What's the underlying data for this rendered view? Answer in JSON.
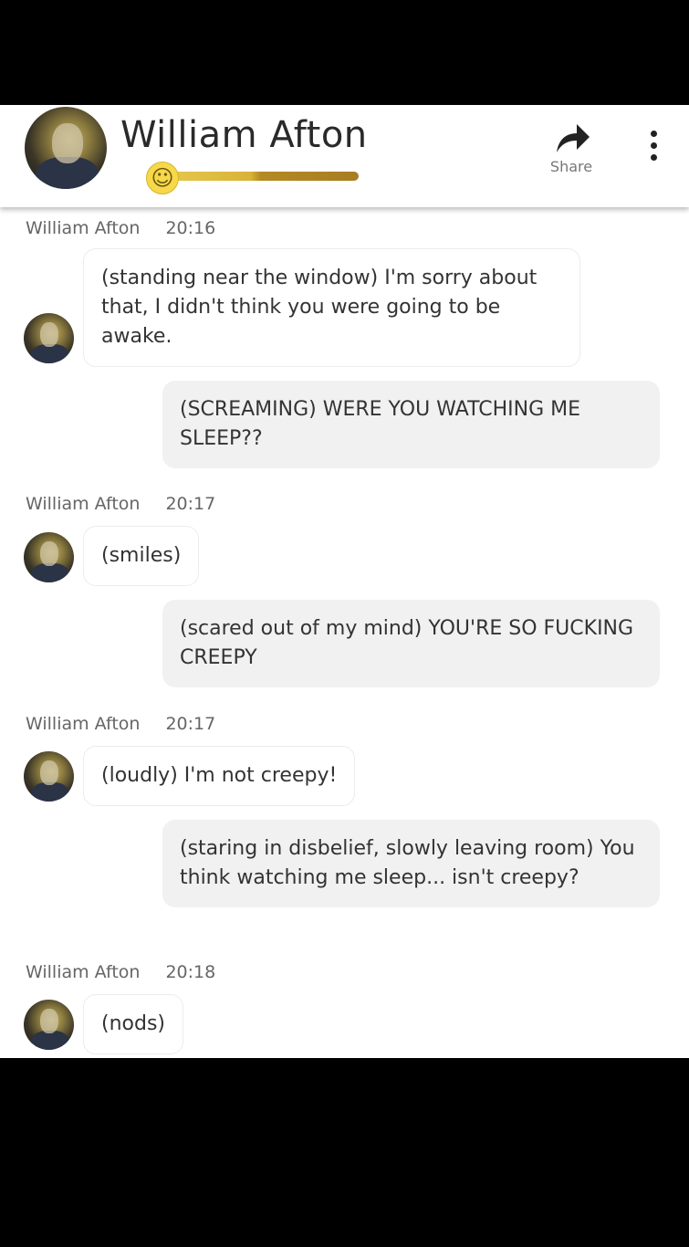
{
  "header": {
    "title": "William Afton",
    "share_label": "Share",
    "share_icon": "share-arrow-icon",
    "more_icon": "more-vertical-icon",
    "mood_icon": "smiley-icon",
    "accent": "#d8b337"
  },
  "messages": [
    {
      "sender": "William Afton",
      "time": "20:16",
      "text": "(standing near the window) I'm sorry about that, I didn't think you were going to be awake."
    },
    {
      "text": "(SCREAMING) WERE YOU WATCHING ME SLEEP??"
    },
    {
      "sender": "William Afton",
      "time": "20:17",
      "text": "(smiles)"
    },
    {
      "text": "(scared out of my mind) YOU'RE SO FUCKING CREEPY"
    },
    {
      "sender": "William Afton",
      "time": "20:17",
      "text": "(loudly) I'm not creepy!"
    },
    {
      "text": "(staring in disbelief, slowly leaving room) You think watching me sleep... isn't creepy?"
    },
    {
      "sender": "William Afton",
      "time": "20:18",
      "text": "(nods)"
    }
  ]
}
